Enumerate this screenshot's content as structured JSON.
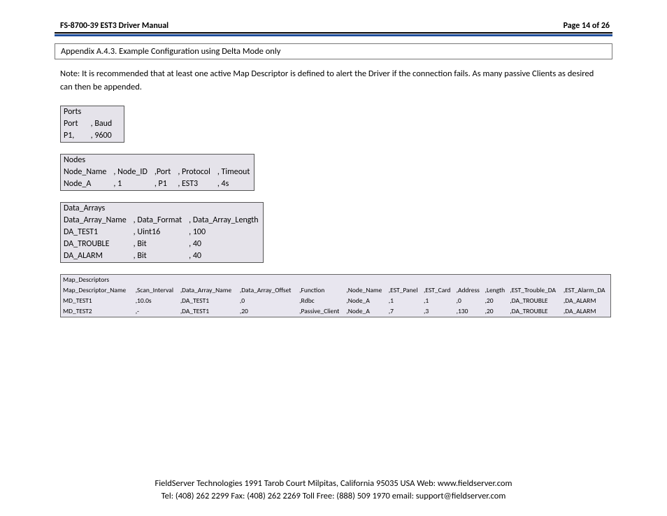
{
  "header": {
    "title": "FS-8700-39 EST3 Driver Manual",
    "page": "Page 14 of 26"
  },
  "section_title": "Appendix A.4.3.  Example Configuration using Delta Mode only",
  "note": "Note:  It is recommended that at least one active Map Descriptor is defined to alert the Driver if the connection fails.  As many passive Clients as desired can then be appended.",
  "ports": {
    "heading": "Ports",
    "cols": [
      "Port",
      ", Baud"
    ],
    "rows": [
      [
        "P1,",
        ", 9600"
      ]
    ]
  },
  "nodes": {
    "heading": "Nodes",
    "cols": [
      "Node_Name",
      ", Node_ID",
      ",Port",
      ", Protocol",
      ", Timeout"
    ],
    "rows": [
      [
        "Node_A",
        ", 1",
        ", P1",
        ", EST3",
        ", 4s"
      ]
    ]
  },
  "data_arrays": {
    "heading": "Data_Arrays",
    "cols": [
      "Data_Array_Name",
      ", Data_Format",
      ", Data_Array_Length"
    ],
    "rows": [
      [
        "DA_TEST1",
        ", Uint16",
        ", 100"
      ],
      [
        "DA_TROUBLE",
        ", Bit",
        ", 40"
      ],
      [
        "DA_ALARM",
        ", Bit",
        ", 40"
      ]
    ]
  },
  "map_descriptors": {
    "heading": "Map_Descriptors",
    "cols": [
      "Map_Descriptor_Name",
      ",Scan_Interval",
      ",Data_Array_Name",
      ",Data_Array_Offset",
      ",Function",
      ",Node_Name",
      ",EST_Panel",
      ",EST_Card",
      ",Address",
      ",Length",
      ",EST_Trouble_DA",
      ",EST_Alarm_DA"
    ],
    "rows": [
      [
        "MD_TEST1",
        ",10.0s",
        ",DA_TEST1",
        ",0",
        ",Rdbc",
        ",Node_A",
        ",1",
        ",1",
        ",0",
        ",20",
        ",DA_TROUBLE",
        ",DA_ALARM"
      ],
      [
        "MD_TEST2",
        ",-",
        ",DA_TEST1",
        ",20",
        ",Passive_Client",
        ",Node_A",
        ",7",
        ",3",
        ",130",
        ",20",
        ",DA_TROUBLE",
        ",DA_ALARM"
      ]
    ]
  },
  "footer": {
    "line1": "FieldServer Technologies 1991 Tarob Court Milpitas, California 95035 USA   Web: www.fieldserver.com",
    "line2": "Tel: (408) 262 2299   Fax: (408) 262 2269   Toll Free: (888) 509 1970   email: support@fieldserver.com"
  }
}
